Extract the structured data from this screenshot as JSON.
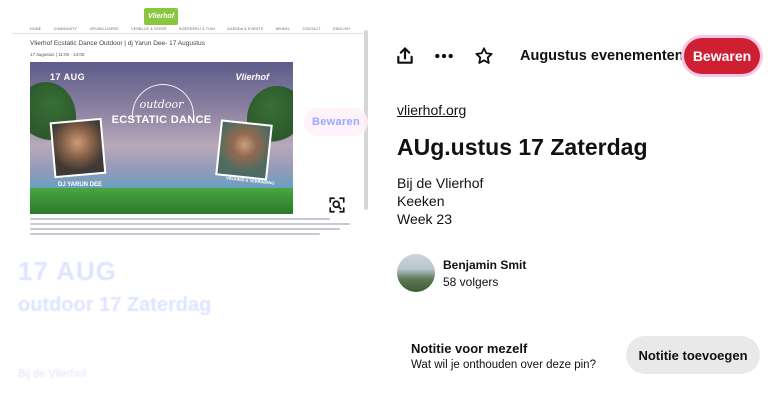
{
  "image_panel": {
    "site": {
      "logo_text": "Vlierhof",
      "nav_items": [
        "Home",
        "Community",
        "Vrijwilligers",
        "Verblijf & Sfeer",
        "Boerderij & Tuin",
        "Agenda & Events",
        "Winkel",
        "Contact",
        "English"
      ],
      "page_heading": "Vlierhof Ecstatic Dance Outdoor | dj Yarun Dee- 17 Augustus",
      "page_date": "17 augustus | 11:00 - 14:00"
    },
    "poster": {
      "date": "17 AUG",
      "brand": "Vlierhof",
      "word1": "outdoor",
      "word2": "ECSTATIC DANCE",
      "dj_left": "DJ YARUN DEE",
      "dj_right": "VRIJHEID & VERBINDING"
    },
    "overlay_save": "Bewaren",
    "visual_search_icon": "lens-search-icon",
    "ghost": {
      "date": "17 AUG",
      "title": "outdoor 17 Zaterdag",
      "venue": "Bij de Vlierhof"
    }
  },
  "actions": {
    "share_icon": "share-icon",
    "more_icon": "more-options-icon",
    "star_icon": "star-icon",
    "board_name": "Augustus evenementen",
    "board_chevron_icon": "chevron-down-icon",
    "save_label": "Bewaren"
  },
  "pin": {
    "source": "vlierhof.org",
    "title": "AUg.ustus 17 Zaterdag",
    "description_lines": [
      "Bij de Vlierhof",
      "Keeken",
      "Week 23"
    ]
  },
  "creator": {
    "name": "Benjamin Smit",
    "followers": "58 volgers"
  },
  "note": {
    "heading": "Notitie voor mezelf",
    "subtitle": "Wat wil je onthouden over deze pin?",
    "button_label": "Notitie toevoegen"
  },
  "colors": {
    "save_red": "#cf1f33",
    "note_button_gray": "#e9e9e9",
    "logo_green": "#8cc63f"
  }
}
